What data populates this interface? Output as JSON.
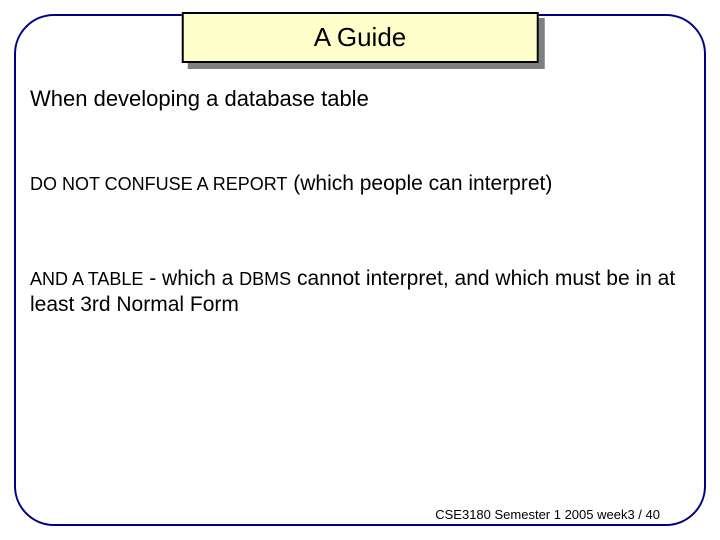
{
  "title": "A Guide",
  "body": {
    "line1": "When developing a database table",
    "line2_caps": "DO NOT CONFUSE A REPORT",
    "line2_rest": " (which people can interpret)",
    "line3_caps1": "AND A TABLE",
    "line3_mid": " - which a ",
    "line3_caps2": "DBMS",
    "line3_rest": " cannot interpret, and which must be in at least 3rd Normal Form"
  },
  "footer": "CSE3180 Semester 1 2005  week3 / 40"
}
